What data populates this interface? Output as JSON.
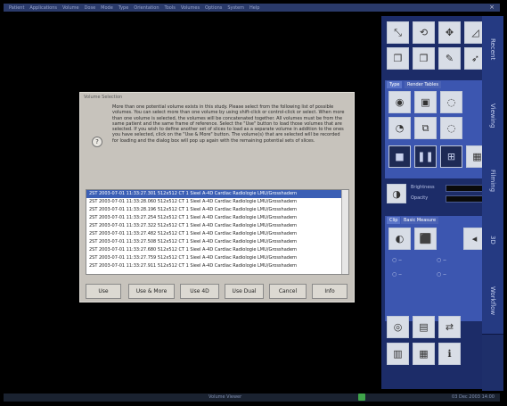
{
  "menubar": {
    "items": [
      "Patient",
      "Applications",
      "Volume",
      "Dose",
      "Mode",
      "Type",
      "Orientation",
      "Tools",
      "Volumes",
      "Options",
      "System",
      "Help"
    ],
    "close_icon": "x-icon"
  },
  "side_tabs": [
    "Recent",
    "Viewing",
    "Filming",
    "3D",
    "Workflow"
  ],
  "right_panel": {
    "tabs": [
      "Type",
      "Render Tables"
    ],
    "slider_labels": [
      "Brightness",
      "Opacity"
    ],
    "measure_tabs": [
      "Clip",
      "Basic Measure"
    ]
  },
  "dialog": {
    "title": "Volume Selection",
    "message": "More than one potential volume exists in this study. Please select from the following list of possible volumes. You can select more than one volume by using shift-click or control-click or select. When more than one volume is selected, the volumes will be concatenated together. All volumes must be from the same patient and the same frame of reference. Select the \"Use\" button to load those volumes that are selected. If you wish to define another set of slices to load as a separate volume in addition to the ones you have selected, click on the \"Use & More\" button. The volume(s) that are selected will be recorded for loading and the dialog box will pop up again with the remaining potential sets of slices.",
    "rows": [
      "2ST 2003-07-01 11:33:27.301 512x512 CT 1 Sieel A-4D Cardiac Radiologie LMU/Grosshadern",
      "2ST 2003-07-01 11:33:28.060 512x512 CT 1 Sieel A-4D Cardiac Radiologie LMU/Grosshadern",
      "2ST 2003-07-01 11:33:28.196 512x512 CT 1 Sieel A-4D Cardiac Radiologie LMU/Grosshadern",
      "2ST 2003-07-01 11:33:27.254 512x512 CT 1 Sieel A-4D Cardiac Radiologie LMU/Grosshadern",
      "2ST 2003-07-01 11:33:27.322 512x512 CT 1 Sieel A-4D Cardiac Radiologie LMU/Grosshadern",
      "2ST 2003-07-01 11:33:27.482 512x512 CT 1 Sieel A-4D Cardiac Radiologie LMU/Grosshadern",
      "2ST 2003-07-01 11:33:27.508 512x512 CT 1 Sieel A-4D Cardiac Radiologie LMU/Grosshadern",
      "2ST 2003-07-01 11:33:27.680 512x512 CT 1 Sieel A-4D Cardiac Radiologie LMU/Grosshadern",
      "2ST 2003-07-01 11:33:27.759 512x512 CT 1 Sieel A-4D Cardiac Radiologie LMU/Grosshadern",
      "2ST 2003-07-01 11:33:27.911 512x512 CT 1 Sieel A-4D Cardiac Radiologie LMU/Grosshadern"
    ],
    "buttons": [
      "Use",
      "Use & More",
      "Use 4D",
      "Use Dual",
      "Cancel",
      "Info"
    ]
  },
  "statusbar": {
    "center": "Volume Viewer",
    "right": "03 Dec 2003 14:00"
  },
  "colors": {
    "accent": "#3b5fb5",
    "panel": "#1c2c68"
  }
}
